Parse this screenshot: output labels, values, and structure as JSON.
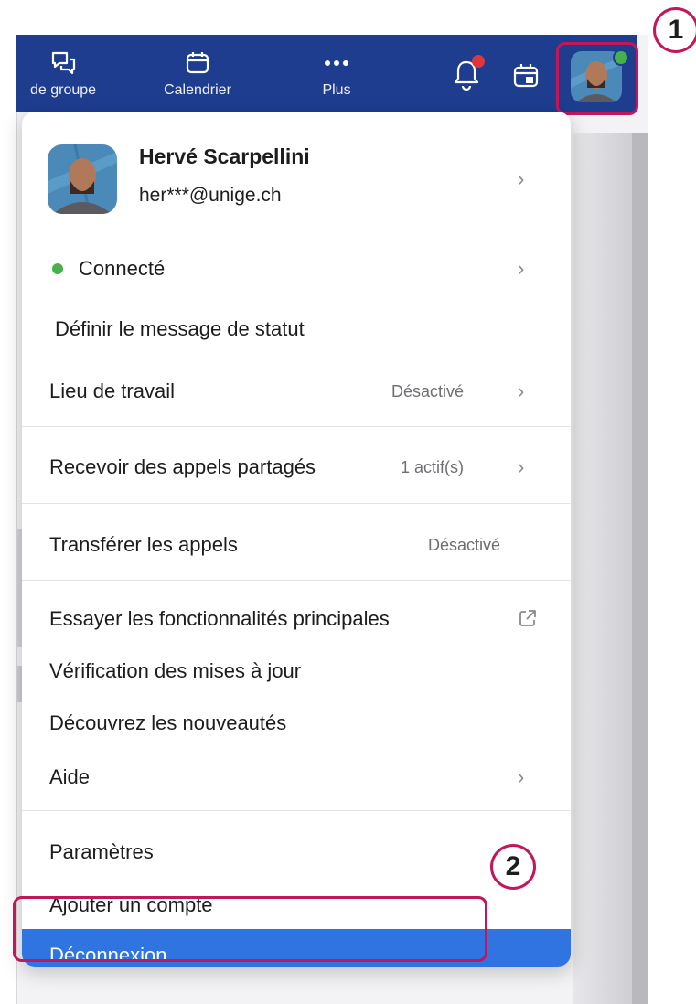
{
  "topbar": {
    "nav": [
      {
        "label": "de groupe",
        "icon": "chat-bubbles-icon"
      },
      {
        "label": "Calendrier",
        "icon": "calendar-icon"
      },
      {
        "label": "Plus",
        "icon": "more-dots-icon"
      }
    ],
    "notification_icon": "bell-icon",
    "calendar_icon": "calendar-icon",
    "avatar_status": "online"
  },
  "annotations": {
    "badge_1": "1",
    "badge_2": "2",
    "accent": "#c2185b"
  },
  "profile": {
    "name": "Hervé Scarpellini",
    "email": "her***@unige.ch"
  },
  "menu": {
    "status": {
      "label": "Connecté"
    },
    "status_message": {
      "label": "Définir le message de statut"
    },
    "workplace": {
      "label": "Lieu de travail",
      "value": "Désactivé"
    },
    "shared_calls": {
      "label": "Recevoir des appels partagés",
      "value": "1 actif(s)"
    },
    "transfer_calls": {
      "label": "Transférer les appels",
      "value": "Désactivé"
    },
    "try_features": {
      "label": "Essayer les fonctionnalités principales"
    },
    "check_updates": {
      "label": "Vérification des mises à jour"
    },
    "whats_new": {
      "label": "Découvrez les nouveautés"
    },
    "help": {
      "label": "Aide"
    },
    "settings": {
      "label": "Paramètres"
    },
    "add_account": {
      "label": "Ajouter un compte"
    },
    "logout": {
      "label": "Déconnexion"
    }
  },
  "colors": {
    "topbar": "#1e3d8f",
    "logout_bg": "#2f74e0",
    "online": "#46b04a",
    "notification_dot": "#e0363b"
  }
}
